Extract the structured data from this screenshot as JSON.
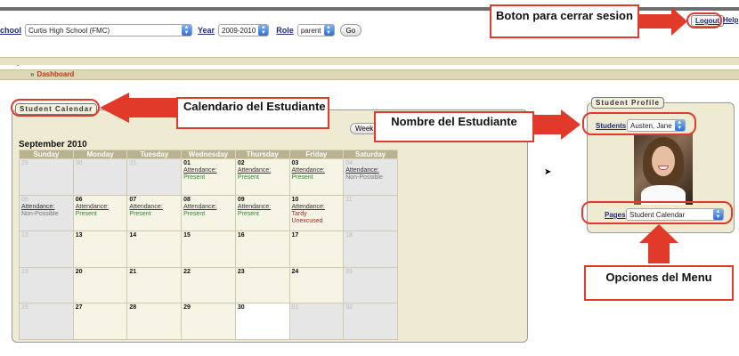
{
  "toolbar": {
    "school_label": "chool",
    "school_value": "Curtis High School (FMC)",
    "year_label": "Year",
    "year_value": "2009-2010",
    "role_label": "Role",
    "role_value": "parent",
    "go_label": "Go"
  },
  "header": {
    "logout": "Logout",
    "help": "Help"
  },
  "breadcrumb": {
    "separator": "»",
    "current": "Dashboard"
  },
  "calendar": {
    "panel_title": "Student Calendar",
    "week_button": "Week",
    "month_title": "September 2010",
    "days": [
      "Sunday",
      "Monday",
      "Tuesday",
      "Wednesday",
      "Thursday",
      "Friday",
      "Saturday"
    ],
    "attendance_label": "Attendance:",
    "weeks": [
      [
        {
          "d": "29",
          "out": true
        },
        {
          "d": "30",
          "out": true
        },
        {
          "d": "31",
          "out": true
        },
        {
          "d": "01",
          "status": "Present",
          "kind": "present"
        },
        {
          "d": "02",
          "status": "Present",
          "kind": "present"
        },
        {
          "d": "03",
          "status": "Present",
          "kind": "present"
        },
        {
          "d": "04",
          "out": true,
          "status": "Non-Possible",
          "kind": "np"
        }
      ],
      [
        {
          "d": "05",
          "out": true,
          "status": "Non-Possible",
          "kind": "np"
        },
        {
          "d": "06",
          "status": "Present",
          "kind": "present"
        },
        {
          "d": "07",
          "status": "Present",
          "kind": "present"
        },
        {
          "d": "08",
          "status": "Present",
          "kind": "present"
        },
        {
          "d": "09",
          "status": "Present",
          "kind": "present"
        },
        {
          "d": "10",
          "status": "Tardy",
          "status2": "Unexcused",
          "kind": "unexc"
        },
        {
          "d": "11",
          "out": true
        }
      ],
      [
        {
          "d": "12",
          "out": true
        },
        {
          "d": "13"
        },
        {
          "d": "14"
        },
        {
          "d": "15"
        },
        {
          "d": "16"
        },
        {
          "d": "17"
        },
        {
          "d": "18",
          "out": true
        }
      ],
      [
        {
          "d": "19",
          "out": true
        },
        {
          "d": "20"
        },
        {
          "d": "21"
        },
        {
          "d": "22"
        },
        {
          "d": "23"
        },
        {
          "d": "24"
        },
        {
          "d": "25",
          "out": true
        }
      ],
      [
        {
          "d": "26",
          "out": true
        },
        {
          "d": "27"
        },
        {
          "d": "28"
        },
        {
          "d": "29"
        },
        {
          "d": "30",
          "white": true
        },
        {
          "d": "01",
          "out": true
        },
        {
          "d": "02",
          "out": true
        }
      ]
    ]
  },
  "profile": {
    "panel_title": "Student Profile",
    "students_label": "Students",
    "student_value": "Austen, Jane",
    "pages_label": "Pages",
    "pages_value": "Student Calendar"
  },
  "annotations": {
    "logout_note": "Boton para cerrar sesion",
    "calendar_note": "Calendario del Estudiante",
    "student_note": "Nombre del Estudiante",
    "menu_note": "Opciones del Menu"
  },
  "colors": {
    "annotation": "#e23a2a",
    "panel": "#eeebd2",
    "header_cell": "#b9b291",
    "present": "#2d8a2d",
    "unexcused": "#c0201a"
  }
}
